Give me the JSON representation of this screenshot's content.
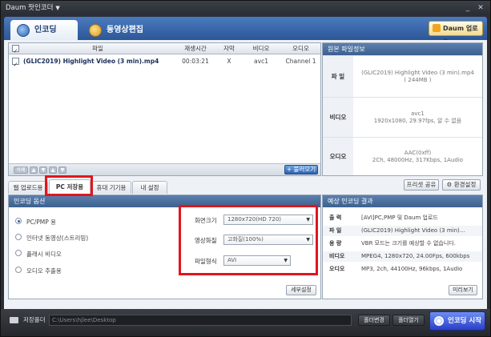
{
  "window": {
    "title": "Daum 팟인코더",
    "title_dropdown": "▼",
    "minimize": "_",
    "close": "✕"
  },
  "main_tabs": [
    {
      "label": "인코딩",
      "active": true
    },
    {
      "label": "동영상편집",
      "active": false
    }
  ],
  "upload_button": "Daum 업로드",
  "file_list": {
    "columns": [
      "파일",
      "재생시간",
      "자막",
      "비디오",
      "오디오"
    ],
    "rows": [
      {
        "file": "(GLIC2019) Highlight Video (3 min).mp4",
        "duration": "00:03:21",
        "subtitle": "X",
        "video": "avc1",
        "audio": "Channel 1",
        "checked": true
      }
    ],
    "add_button": "+ 불러오기",
    "nav_buttons": [
      "삭제",
      "▲",
      "▼",
      "▲",
      "▼"
    ]
  },
  "source_info": {
    "title": "원본 파일정보",
    "rows": [
      {
        "label": "파 일",
        "value": "(GLIC2019) Highlight Video (3 min).mp4\n( 244MB )"
      },
      {
        "label": "비디오",
        "value": "avc1\n1920x1080, 29.97fps, 알 수 없음"
      },
      {
        "label": "오디오",
        "value": "AAC(0xff)\n2Ch, 48000Hz, 317Kbps, 1Audio"
      }
    ]
  },
  "sub_tabs": [
    {
      "label": "웹 업로드용",
      "active": false
    },
    {
      "label": "PC 저장용",
      "active": true
    },
    {
      "label": "휴대 기기용",
      "active": false
    },
    {
      "label": "내 설정",
      "active": false
    }
  ],
  "right_buttons": {
    "share": "프리셋 공유",
    "settings": "⚙ 환경설정"
  },
  "encoding_options": {
    "title": "인코딩 옵션",
    "radios": [
      {
        "label": "PC/PMP 용",
        "selected": true
      },
      {
        "label": "인터넷 동영상(스트리밍)",
        "selected": false
      },
      {
        "label": "플래시 비디오",
        "selected": false
      },
      {
        "label": "오디오 추출용",
        "selected": false
      }
    ],
    "fields": [
      {
        "label": "화면크기",
        "value": "1280x720(HD 720)"
      },
      {
        "label": "영상화질",
        "value": "고화질(100%)"
      },
      {
        "label": "파일형식",
        "value": "AVI"
      }
    ],
    "detail_button": "세부설정"
  },
  "expected_result": {
    "title": "예상 인코딩 결과",
    "rows": [
      {
        "label": "출 력",
        "value": "[AVI]PC,PMP 및 Daum 업로드"
      },
      {
        "label": "파 일",
        "value": "(GLIC2019) Highlight Video (3 min)..."
      },
      {
        "label": "용 량",
        "value": "VBR 모드는 크기를 예상할 수 없습니다."
      },
      {
        "label": "비디오",
        "value": "MPEG4, 1280x720, 24.00Fps, 600kbps"
      },
      {
        "label": "오디오",
        "value": "MP3, 2ch, 44100Hz, 96kbps, 1Audio"
      }
    ],
    "preview_button": "미리보기"
  },
  "bottom_bar": {
    "folder_label": "저장폴더",
    "path": "C:\\Users\\hjlee\\Desktop",
    "change_folder": "폴더변경",
    "open_folder": "폴더열기",
    "start_button": "인코딩 시작"
  },
  "colors": {
    "highlight": "#e0161d",
    "accent": "#2c5698"
  }
}
